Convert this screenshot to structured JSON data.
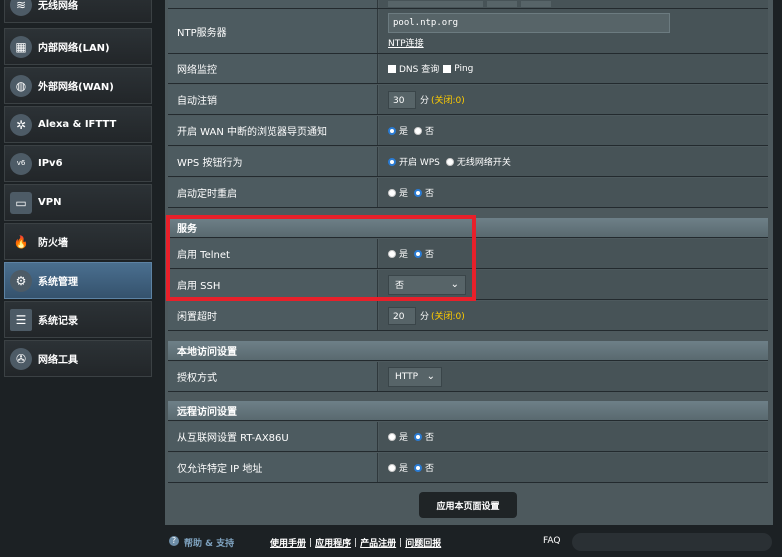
{
  "sidebar": {
    "items": [
      {
        "label": "无线网络",
        "icon": "wifi-icon",
        "active": false
      },
      {
        "label": "内部网络(LAN)",
        "icon": "lan-icon",
        "active": false
      },
      {
        "label": "外部网络(WAN)",
        "icon": "globe-icon",
        "active": false
      },
      {
        "label": "Alexa & IFTTT",
        "icon": "alexa-icon",
        "active": false
      },
      {
        "label": "IPv6",
        "icon": "ipv6-icon",
        "active": false
      },
      {
        "label": "VPN",
        "icon": "vpn-icon",
        "active": false
      },
      {
        "label": "防火墙",
        "icon": "firewall-icon",
        "active": false
      },
      {
        "label": "系统管理",
        "icon": "gear-icon",
        "active": true
      },
      {
        "label": "系统记录",
        "icon": "log-icon",
        "active": false
      },
      {
        "label": "网络工具",
        "icon": "tools-icon",
        "active": false
      }
    ]
  },
  "ntp": {
    "label": "NTP服务器",
    "value": "pool.ntp.org",
    "link": "NTP连接"
  },
  "net_monitor": {
    "label": "网络监控",
    "dns": "DNS 查询",
    "ping": "Ping"
  },
  "auto_logout": {
    "label": "自动注销",
    "value": "30",
    "unit": "分",
    "hint": "(关闭:0)"
  },
  "wan_notify": {
    "label": "开启 WAN 中断的浏览器导页通知",
    "yes": "是",
    "no": "否"
  },
  "wps": {
    "label": "WPS 按钮行为",
    "opt1": "开启 WPS",
    "opt2": "无线网络开关"
  },
  "reboot": {
    "label": "启动定时重启",
    "yes": "是",
    "no": "否"
  },
  "services": {
    "title": "服务",
    "telnet": {
      "label": "启用 Telnet",
      "yes": "是",
      "no": "否"
    },
    "ssh": {
      "label": "启用 SSH",
      "selected": "否"
    },
    "idle": {
      "label": "闲置超时",
      "value": "20",
      "unit": "分",
      "hint": "(关闭:0)"
    }
  },
  "local_access": {
    "title": "本地访问设置",
    "auth": {
      "label": "授权方式",
      "selected": "HTTP"
    }
  },
  "remote_access": {
    "title": "远程访问设置",
    "internet": {
      "label": "从互联网设置 RT-AX86U",
      "yes": "是",
      "no": "否"
    },
    "specific_ip": {
      "label": "仅允许特定 IP 地址",
      "yes": "是",
      "no": "否"
    }
  },
  "apply_button": "应用本页面设置",
  "footer": {
    "help": "帮助 & 支持",
    "manual": "使用手册",
    "app": "应用程序",
    "register": "产品注册",
    "feedback": "问题回报",
    "faq": "FAQ"
  },
  "colors": {
    "highlight": "#e8202a",
    "accent": "#2a7bd3",
    "hint": "#ffcc00"
  }
}
